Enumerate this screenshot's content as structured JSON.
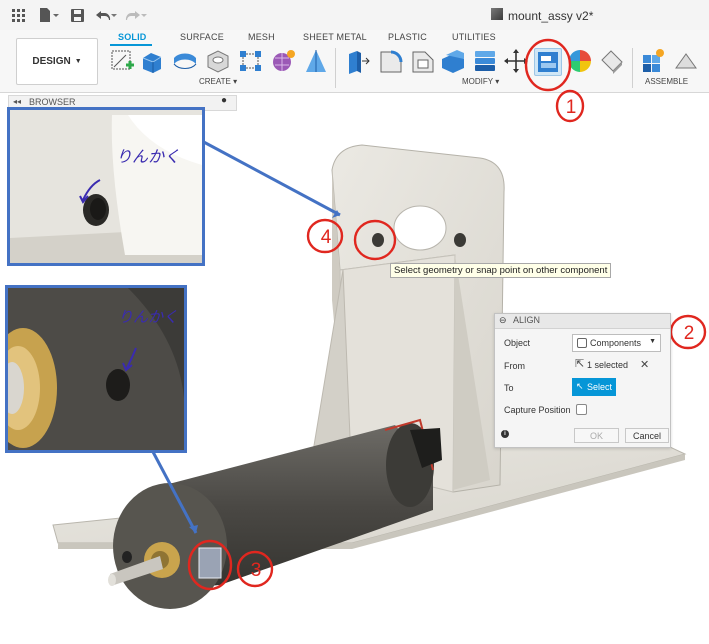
{
  "titlebar": {
    "doc_title": "mount_assy v2*"
  },
  "ribbon": {
    "workspace_label": "DESIGN",
    "tabs": [
      {
        "label": "SOLID",
        "active": true
      },
      {
        "label": "SURFACE",
        "active": false
      },
      {
        "label": "MESH",
        "active": false
      },
      {
        "label": "SHEET METAL",
        "active": false
      },
      {
        "label": "PLASTIC",
        "active": false
      },
      {
        "label": "UTILITIES",
        "active": false
      }
    ],
    "groups": {
      "create": "CREATE",
      "modify": "MODIFY",
      "assemble": "ASSEMBLE"
    }
  },
  "browser": {
    "label": "BROWSER"
  },
  "tooltip": {
    "text": "Select geometry or snap point on other component"
  },
  "align_dialog": {
    "title": "ALIGN",
    "object_label": "Object",
    "object_value": "Components",
    "from_label": "From",
    "from_value": "1 selected",
    "to_label": "To",
    "to_button": "Select",
    "capture_label": "Capture Position",
    "ok_label": "OK",
    "cancel_label": "Cancel"
  },
  "annotations": {
    "marks": [
      "1",
      "2",
      "3",
      "4"
    ],
    "note_upper": "りんかく",
    "note_lower": "りんかく",
    "color": "#e0271f",
    "note_color": "#3a2bb0",
    "frame_color": "#4472c4"
  },
  "accent_color": "#0696d7"
}
